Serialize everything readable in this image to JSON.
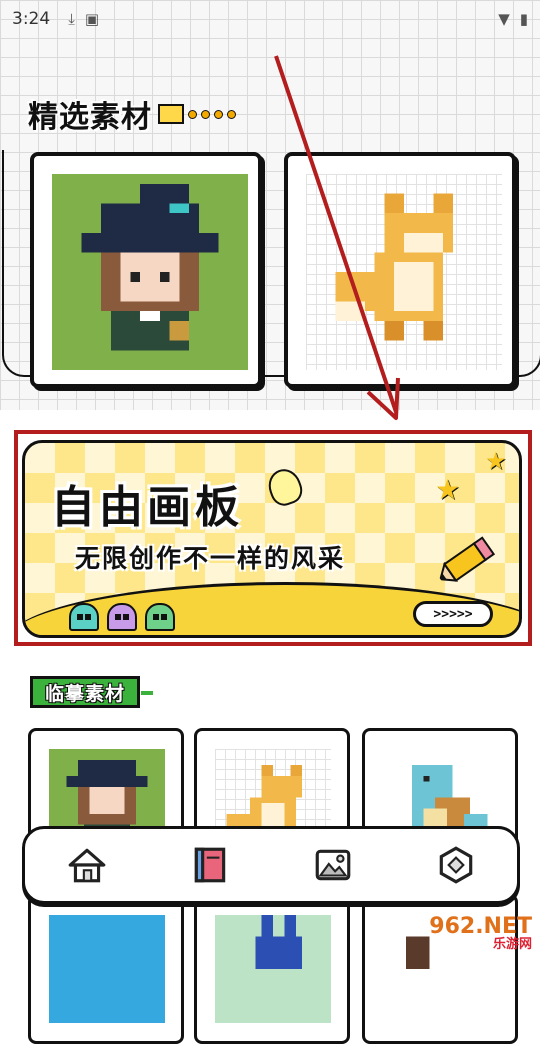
{
  "status_bar": {
    "time": "3:24",
    "icons": [
      "download-icon",
      "notification-app-icon"
    ],
    "right_icons": [
      "wifi-icon",
      "battery-icon"
    ]
  },
  "featured": {
    "title": "精选素材",
    "items": [
      {
        "name": "witch-girl-pixel-art"
      },
      {
        "name": "fox-pixel-art"
      }
    ]
  },
  "banner": {
    "title": "自由画板",
    "subtitle": "无限创作不一样的风采",
    "button_label": ">>>>>"
  },
  "copy_section": {
    "title": "临摹素材",
    "items": [
      {
        "name": "witch-girl-pixel-art"
      },
      {
        "name": "cat-pixel-art"
      },
      {
        "name": "squirtle-pixel-art"
      },
      {
        "name": "blue-pixel-art"
      },
      {
        "name": "blue-creature-pixel-art"
      },
      {
        "name": "character-pixel-art"
      }
    ]
  },
  "nav": {
    "items": [
      {
        "icon": "home-icon"
      },
      {
        "icon": "book-icon"
      },
      {
        "icon": "gallery-icon"
      },
      {
        "icon": "settings-icon"
      }
    ]
  },
  "watermark": {
    "logo": "962.NET",
    "text": "乐游网"
  },
  "colors": {
    "highlight_border": "#b31d1d",
    "banner_yellow": "#f7d43a",
    "section_green": "#3bb23b",
    "arrow_red": "#b31d1d"
  }
}
